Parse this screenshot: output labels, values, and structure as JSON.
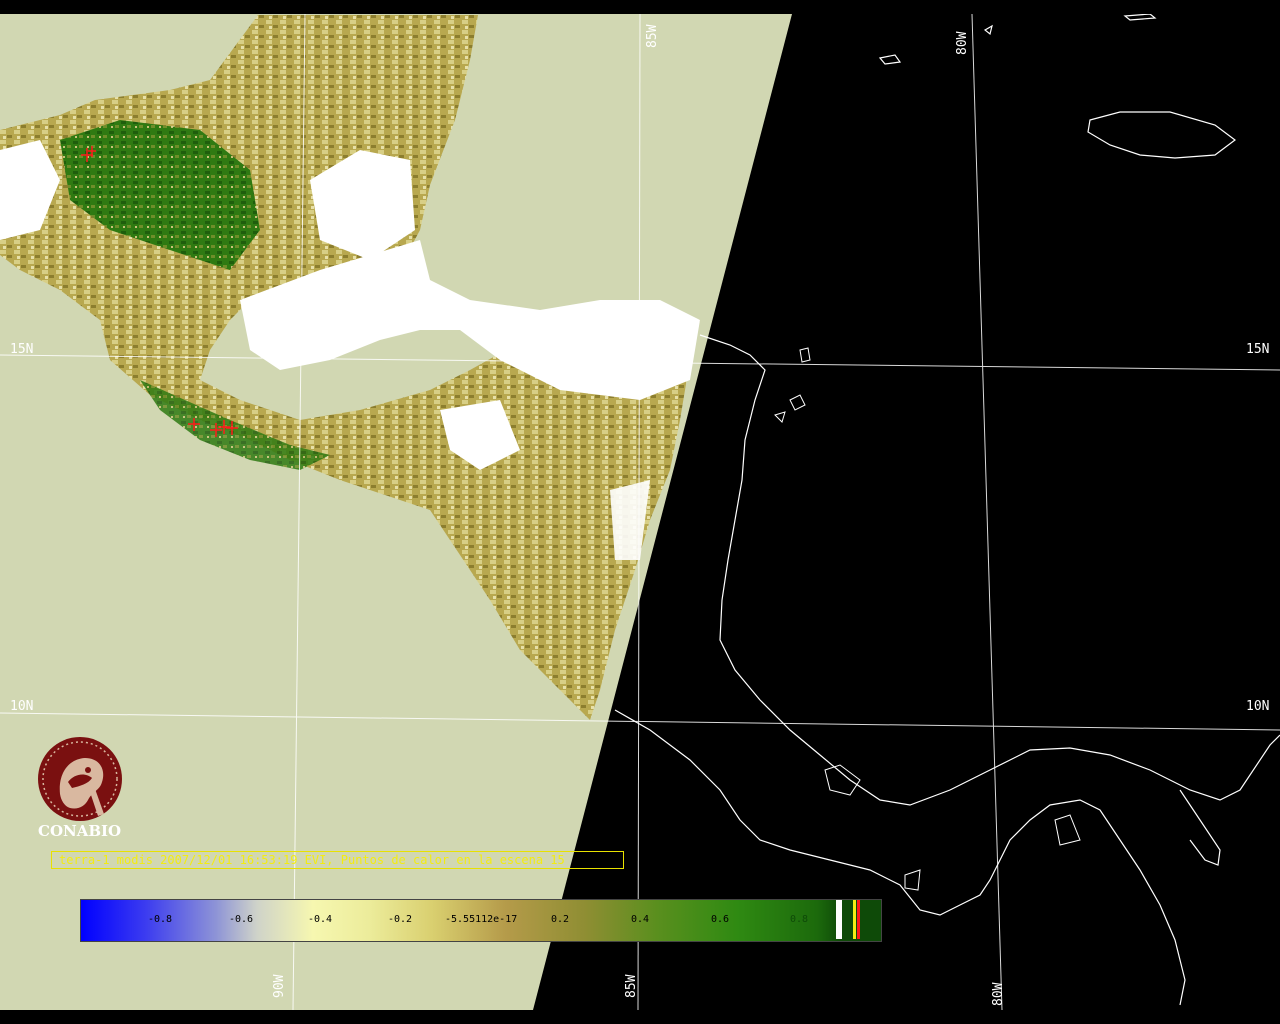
{
  "map": {
    "lat_labels": [
      "15N",
      "10N"
    ],
    "lon_labels": [
      "90W",
      "85W",
      "80W"
    ],
    "logo_text": "CONABIO",
    "caption": "terra-1 modis 2007/12/01 16:53:19 EVI, Puntos de calor en la escena 15",
    "scale_ticks": [
      "-0.8",
      "-0.6",
      "-0.4",
      "-0.2",
      "-5.55112e-17",
      "0.2",
      "0.4",
      "0.6",
      "0.8"
    ],
    "colors": {
      "no_data": "#d1d7b2",
      "night": "#000000",
      "vegetation_high": "#1c6a0c",
      "vegetation_mid": "#a8913f",
      "cloud": "#ffffff",
      "hotspot": "#ff1a1a",
      "caption_text": "#f3ec14",
      "logo": "#7a1010"
    }
  }
}
